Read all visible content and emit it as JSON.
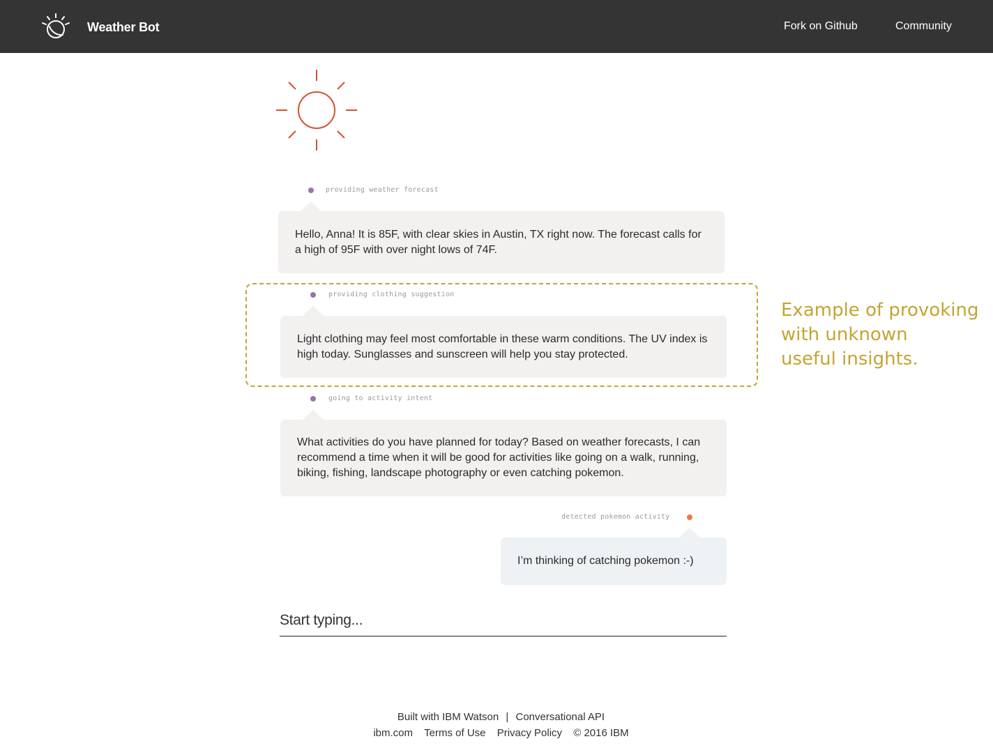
{
  "header": {
    "app_title": "Weather Bot",
    "nav": {
      "fork_label": "Fork on Github",
      "community_label": "Community"
    }
  },
  "conversation": [
    {
      "speaker": "bot",
      "intent": "providing weather forecast",
      "message": "Hello, Anna! It is 85F, with clear skies in Austin, TX right now. The forecast calls for a high of 95F with over night lows of 74F."
    },
    {
      "speaker": "bot",
      "intent": "providing clothing suggestion",
      "message": "Light clothing may feel most comfortable in these warm conditions. The UV index is high today. Sunglasses and sunscreen will help you stay protected."
    },
    {
      "speaker": "bot",
      "intent": "going to activity intent",
      "message": "What activities do you have planned for today? Based on weather forecasts, I can recommend a time when it will be good for activities like going on a walk, running, biking, fishing, landscape photography or even catching pokemon."
    },
    {
      "speaker": "user",
      "intent": "detected pokemon activity",
      "message": "I’m thinking of catching pokemon :-)"
    }
  ],
  "annotation": {
    "line1": "Example of provoking",
    "line2": "with unknown",
    "line3": "useful insights."
  },
  "input": {
    "placeholder": "Start typing..."
  },
  "footer": {
    "built_with": "Built with IBM Watson",
    "separator": "|",
    "api": "Conversational API",
    "links": [
      "ibm.com",
      "Terms of Use",
      "Privacy Policy",
      "© 2016 IBM"
    ]
  },
  "colors": {
    "topbar": "#343434",
    "sun": "#d7502c",
    "bot_dot": "#9b72b0",
    "user_dot": "#ec7a3c",
    "bot_bubble": "#f3f0f0",
    "user_bubble": "#eef2f4",
    "annotation": "#c2a532"
  },
  "icons": {
    "logo": "ibm-watson-logo-icon",
    "weather": "sun-icon"
  }
}
